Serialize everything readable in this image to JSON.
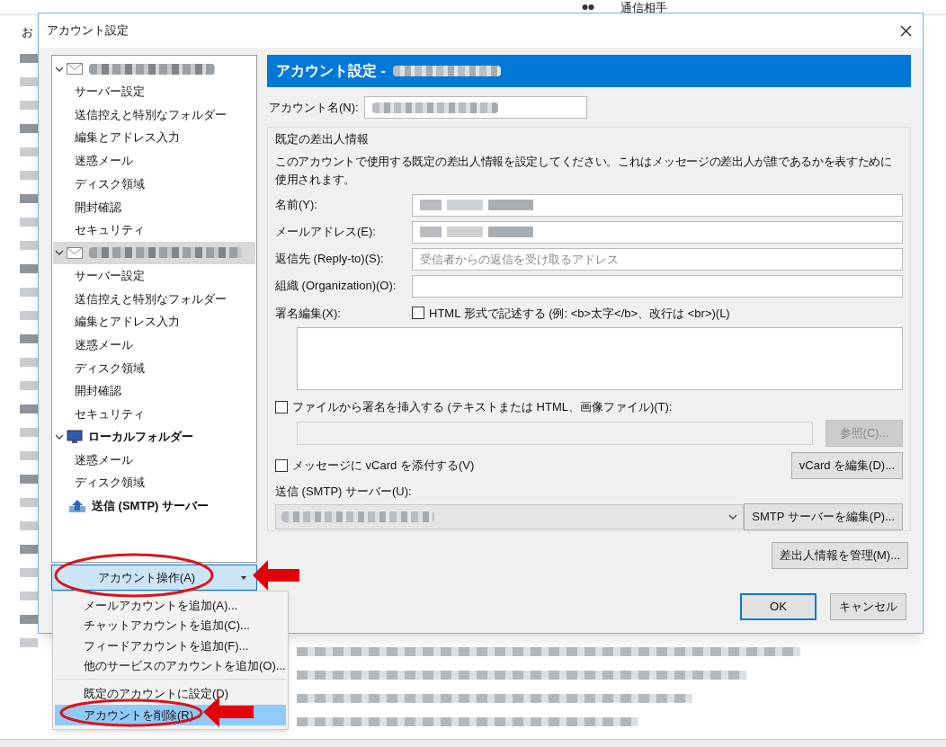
{
  "background_app": {
    "column_1_header": "お",
    "column_2_header": "通信相手"
  },
  "window": {
    "title": "アカウント設定"
  },
  "tree": [
    {
      "kind": "mail",
      "expanded": true,
      "selected": false,
      "children": [
        {
          "label": "サーバー設定",
          "selected": false
        },
        {
          "label": "送信控えと特別なフォルダー",
          "selected": false
        },
        {
          "label": "編集とアドレス入力",
          "selected": false
        },
        {
          "label": "迷惑メール",
          "selected": false
        },
        {
          "label": "ディスク領域",
          "selected": false
        },
        {
          "label": "開封確認",
          "selected": false
        },
        {
          "label": "セキュリティ",
          "selected": false
        }
      ]
    },
    {
      "kind": "mail",
      "expanded": true,
      "selected": true,
      "children": [
        {
          "label": "サーバー設定",
          "selected": false
        },
        {
          "label": "送信控えと特別なフォルダー",
          "selected": false
        },
        {
          "label": "編集とアドレス入力",
          "selected": false
        },
        {
          "label": "迷惑メール",
          "selected": false
        },
        {
          "label": "ディスク領域",
          "selected": false
        },
        {
          "label": "開封確認",
          "selected": false
        },
        {
          "label": "セキュリティ",
          "selected": false
        }
      ]
    },
    {
      "kind": "local",
      "label": "ローカルフォルダー",
      "expanded": true,
      "selected": false,
      "children": [
        {
          "label": "迷惑メール",
          "selected": false
        },
        {
          "label": "ディスク領域",
          "selected": false
        }
      ]
    },
    {
      "kind": "smtp",
      "label": "送信 (SMTP) サーバー",
      "selected": false
    }
  ],
  "account_actions": {
    "label": "アカウント操作(A)",
    "menu": [
      {
        "label": "メールアカウントを追加(A)...",
        "selected": false,
        "separator_before": false
      },
      {
        "label": "チャットアカウントを追加(C)...",
        "selected": false,
        "separator_before": false
      },
      {
        "label": "フィードアカウントを追加(F)...",
        "selected": false,
        "separator_before": false
      },
      {
        "label": "他のサービスのアカウントを追加(O)...",
        "selected": false,
        "separator_before": false
      },
      {
        "label": "既定のアカウントに設定(D)",
        "selected": false,
        "separator_before": true
      },
      {
        "label": "アカウントを削除(R)",
        "selected": true,
        "separator_before": false
      }
    ]
  },
  "panel": {
    "header": "アカウント設定 -",
    "account_name": {
      "label": "アカウント名(N):",
      "redacted": true
    },
    "identity": {
      "title": "既定の差出人情報",
      "description": "このアカウントで使用する既定の差出人情報を設定してください。これはメッセージの差出人が誰であるかを表すために使用されます。",
      "fields": [
        {
          "label": "名前(Y):",
          "redacted": true
        },
        {
          "label": "メールアドレス(E):",
          "redacted": true
        },
        {
          "label": "返信先 (Reply-to)(S):",
          "redacted": false,
          "placeholder": "受信者からの返信を受け取るアドレス"
        },
        {
          "label": "組織 (Organization)(O):",
          "redacted": false
        }
      ],
      "signature": {
        "label": "署名編集(X):",
        "html_checkbox": {
          "label": "HTML 形式で記述する (例: <b>太字</b>、改行は <br>)(L)",
          "checked": false
        }
      },
      "file_signature": {
        "label": "ファイルから署名を挿入する (テキストまたは HTML、画像ファイル)(T):",
        "checked": false,
        "browse_button": {
          "label": "参照(C)...",
          "disabled": true
        }
      },
      "vcard": {
        "label": "メッセージに vCard を添付する(V)",
        "checked": false,
        "edit_button": "vCard を編集(D)..."
      },
      "smtp": {
        "label": "送信 (SMTP) サーバー(U):",
        "redacted": true,
        "edit_button": "SMTP サーバーを編集(P)..."
      }
    },
    "manage_button": "差出人情報を管理(M)...",
    "buttons": [
      {
        "label": "OK",
        "default": true
      },
      {
        "label": "キャンセル",
        "default": false
      }
    ]
  }
}
